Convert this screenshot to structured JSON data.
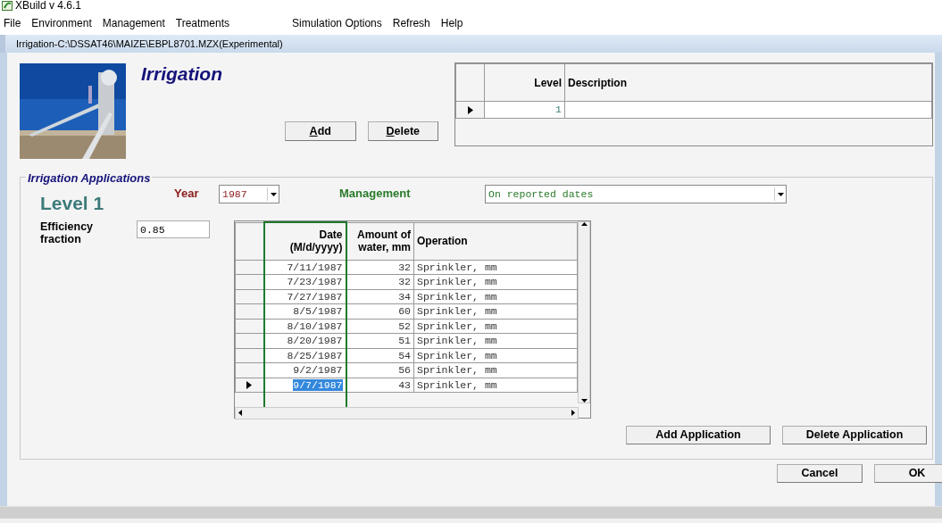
{
  "app": {
    "title": "XBuild v 4.6.1"
  },
  "menu": [
    "File",
    "Environment",
    "Management",
    "Treatments",
    "Simulation Options",
    "Refresh",
    "Help"
  ],
  "window": {
    "title": "Irrigation-C:\\DSSAT46\\MAIZE\\EBPL8701.MZX(Experimental)"
  },
  "header": {
    "title": "Irrigation",
    "buttons": [
      {
        "label": "Add",
        "mnemonic_underlined": true
      },
      {
        "label": "Delete",
        "mnemonic_underlined": true
      }
    ]
  },
  "levels": {
    "columns": [
      "Level",
      "Description"
    ],
    "rows": [
      {
        "level": "1",
        "selected": true
      }
    ]
  },
  "applications": {
    "title": "Irrigation Applications",
    "level_label": "Level 1",
    "year": {
      "label": "Year",
      "value": "1987"
    },
    "management": {
      "label": "Management",
      "value": "On reported dates"
    },
    "efficiency": {
      "label": "Efficiency fraction",
      "value": "0.85"
    },
    "table": {
      "columns": [
        {
          "label": "Date (M/d/yyyy)",
          "focused": true
        },
        {
          "label": "Amount of water, mm",
          "focused": false
        },
        {
          "label": "Operation",
          "focused": false
        }
      ],
      "rows": [
        {
          "date": "7/11/1987",
          "amount": "32",
          "operation": "Sprinkler, mm",
          "selected": false
        },
        {
          "date": "7/23/1987",
          "amount": "32",
          "operation": "Sprinkler, mm",
          "selected": false
        },
        {
          "date": "7/27/1987",
          "amount": "34",
          "operation": "Sprinkler, mm",
          "selected": false
        },
        {
          "date": "8/5/1987",
          "amount": "60",
          "operation": "Sprinkler, mm",
          "selected": false
        },
        {
          "date": "8/10/1987",
          "amount": "52",
          "operation": "Sprinkler, mm",
          "selected": false
        },
        {
          "date": "8/20/1987",
          "amount": "51",
          "operation": "Sprinkler, mm",
          "selected": false
        },
        {
          "date": "8/25/1987",
          "amount": "54",
          "operation": "Sprinkler, mm",
          "selected": false
        },
        {
          "date": "9/2/1987",
          "amount": "56",
          "operation": "Sprinkler, mm",
          "selected": false
        },
        {
          "date": "9/7/1987",
          "amount": "43",
          "operation": "Sprinkler, mm",
          "selected": true
        }
      ]
    },
    "buttons": [
      "Add Application",
      "Delete Application"
    ]
  },
  "dialog_buttons": [
    "Cancel",
    "OK"
  ]
}
